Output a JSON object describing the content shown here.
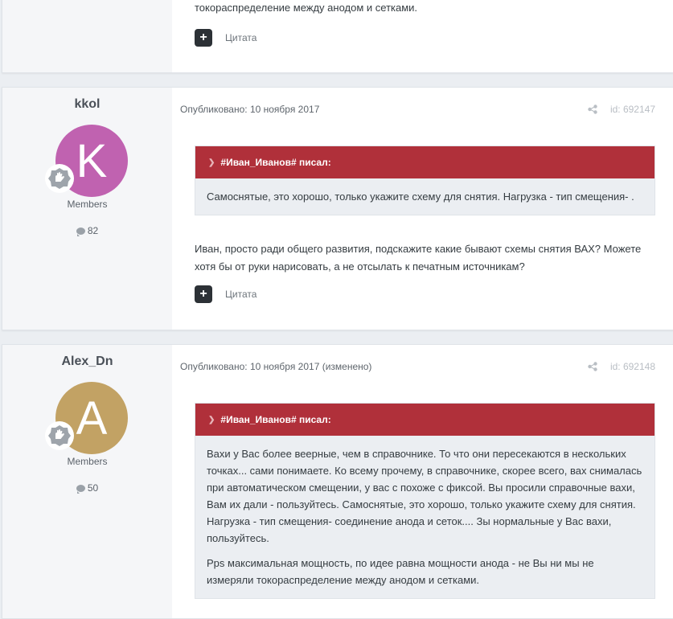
{
  "top_post": {
    "text_tail": "токораспределение между анодом и сетками.",
    "quote_label": "Цитата"
  },
  "posts": [
    {
      "author": "kkol",
      "avatar_letter": "K",
      "avatar_color": "#c062b0",
      "group": "Members",
      "post_count": "82",
      "published": "Опубликовано: 10 ноября 2017",
      "post_id": "id: 692147",
      "quote_author": "#Иван_Иванов# писал:",
      "quote_paragraphs": [
        "Самоснятые, это хорошо, только укажите схему для снятия. Нагрузка - тип смещения- ."
      ],
      "text": "Иван, просто ради общего развития, подскажите какие бывают схемы снятия ВАХ? Можете хотя бы от руки нарисовать, а не отсылать к печатным источникам?",
      "quote_label": "Цитата"
    },
    {
      "author": "Alex_Dn",
      "avatar_letter": "A",
      "avatar_color": "#c2a264",
      "group": "Members",
      "post_count": "50",
      "published": "Опубликовано: 10 ноября 2017 (изменено)",
      "post_id": "id: 692148",
      "quote_author": "#Иван_Иванов# писал:",
      "quote_paragraphs": [
        "Вахи у Вас более веерные, чем в справочнике. То что они пересекаются в нескольких точках... сами понимаете. Ко всему прочему, в справочнике, скорее всего, вах снималась при автоматическом смещении, у вас с похоже с фиксой. Вы просили справочные вахи, Вам их дали - пользуйтесь. Самоснятые, это хорошо, только укажите схему для снятия. Нагрузка - тип смещения- соединение анода и сеток.... Зы нормальные у Вас вахи, пользуйтесь.",
        "Pps максимальная мощность, по идее равна мощности анода - не Вы ни мы не измеряли токораспределение между анодом и сетками."
      ]
    }
  ],
  "icons": {
    "add": "plus-icon",
    "share": "share-icon",
    "comment": "comment-bubble-icon",
    "rank": "rank-badge-icon",
    "collapse": "chevron-down-icon"
  },
  "colors": {
    "quote_header": "#b0303a",
    "page_bg": "#ebeef2",
    "author_col_bg": "#f5f6f8"
  }
}
